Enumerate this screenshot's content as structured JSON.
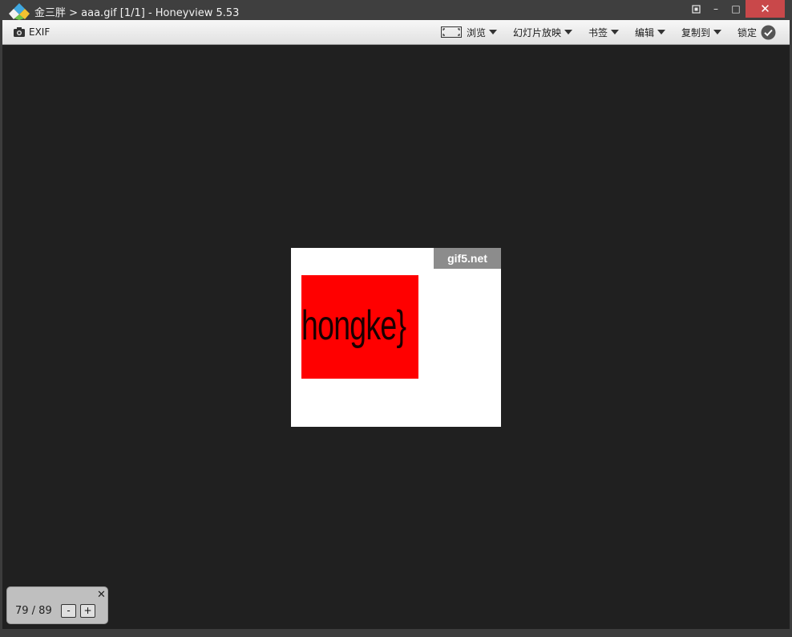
{
  "window": {
    "title": "金三胖 > aaa.gif [1/1] - Honeyview 5.53",
    "minimize_glyph": "–",
    "maximize_glyph": "□",
    "close_glyph": "✕",
    "restore_icon": "fullscreen-icon"
  },
  "toolbar": {
    "exif_label": "EXIF",
    "browse_label": "浏览",
    "slideshow_label": "幻灯片放映",
    "bookmark_label": "书签",
    "edit_label": "编辑",
    "copy_to_label": "复制到",
    "lock_label": "锁定"
  },
  "image": {
    "watermark": "gif5.net",
    "text": "hongke}",
    "background_color": "#ffffff",
    "box_color": "#ff0000"
  },
  "frame_panel": {
    "counter": "79 / 89",
    "minus_label": "-",
    "plus_label": "+",
    "close_glyph": "✕"
  },
  "colors": {
    "titlebar": "#3f3f3f",
    "close_button": "#c9484a",
    "viewer_background": "#202020"
  }
}
